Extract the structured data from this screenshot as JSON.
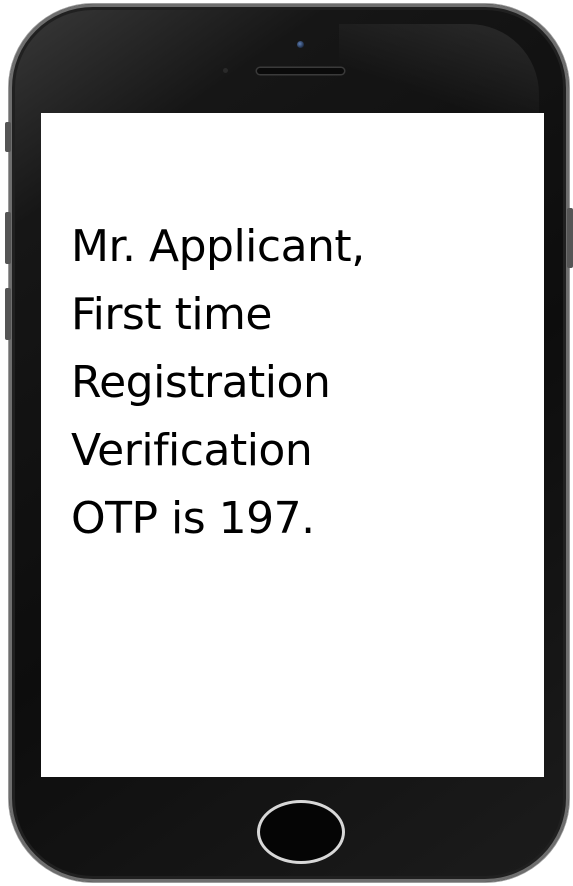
{
  "message": {
    "lines": [
      "Mr. Applicant,",
      "First time",
      "Registration",
      "Verification",
      "OTP is 197."
    ]
  },
  "colors": {
    "phone_body": "#0d0d0d",
    "screen_background": "#ffffff",
    "text": "#000000",
    "home_ring": "#d8d8d8"
  },
  "icons": {
    "camera": "front-camera-icon",
    "speaker": "earpiece-speaker-icon",
    "home": "home-button"
  }
}
